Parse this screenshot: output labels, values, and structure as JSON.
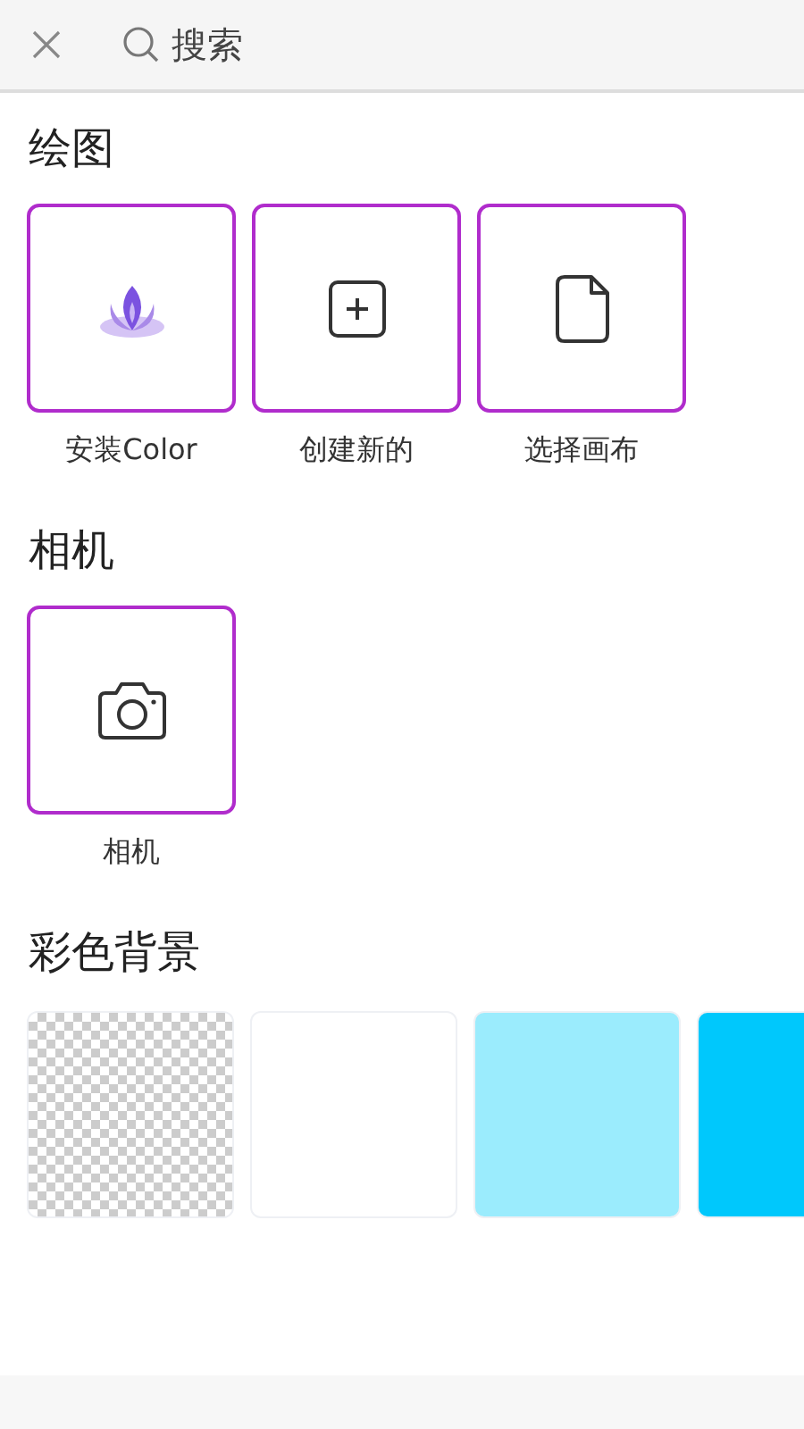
{
  "search": {
    "placeholder": "搜索"
  },
  "sections": [
    {
      "title": "绘图",
      "tiles": [
        {
          "kind": "lotus",
          "label": "安装Color"
        },
        {
          "kind": "plus",
          "label": "创建新的"
        },
        {
          "kind": "file",
          "label": "选择画布"
        }
      ]
    },
    {
      "title": "相机",
      "tiles": [
        {
          "kind": "camera",
          "label": "相机"
        }
      ]
    }
  ],
  "backgrounds": {
    "title": "彩色背景",
    "swatches": [
      {
        "kind": "transparent"
      },
      {
        "kind": "color",
        "color": "#ffffff"
      },
      {
        "kind": "color",
        "color": "#9becfd"
      },
      {
        "kind": "color",
        "color": "#00c8fc"
      }
    ]
  }
}
